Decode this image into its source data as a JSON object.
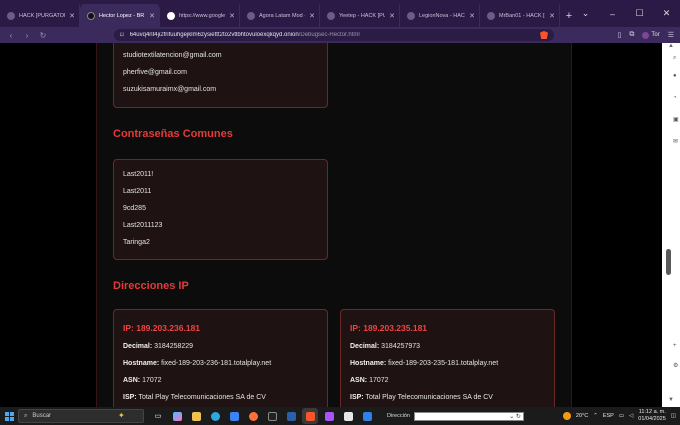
{
  "tabs": [
    {
      "title": "HACK [PURGATORY]",
      "active": false
    },
    {
      "title": "Hector Lopez - BR",
      "active": true
    },
    {
      "title": "https://www.google.co",
      "active": false
    },
    {
      "title": "Agora Latam Mod - R",
      "active": false
    },
    {
      "title": "Yeetep - HACK [PURG",
      "active": false
    },
    {
      "title": "LegionNova - HACK [I",
      "active": false
    },
    {
      "title": "MrBan01 - HACK [PUR",
      "active": false
    }
  ],
  "toolbar": {
    "url_host": "64uvq4nt4ji2frifuuhgejklm6zysiettt2to2vtlbhtovuloexqkqyd.onion",
    "url_path": "/Debugsec-Hector.html",
    "tor_label": "Tor"
  },
  "emails": [
    "studiotextilatencion@gmail.com",
    "pherfive@gmail.com",
    "suzukisamuraimx@gmail.com"
  ],
  "passwords_heading": "Contraseñas Comunes",
  "passwords": [
    "Last2011!",
    "Last2011",
    "9cd285",
    "Last2011123",
    "Taringa2"
  ],
  "ip_heading": "Direcciones IP",
  "labels": {
    "decimal": "Decimal:",
    "hostname": "Hostname:",
    "asn": "ASN:",
    "isp": "ISP:"
  },
  "ips": [
    {
      "title": "IP: 189.203.236.181",
      "decimal": "3184258229",
      "hostname": "fixed-189-203-236-181.totalplay.net",
      "asn": "17072",
      "isp": "Total Play Telecomunicaciones SA de CV"
    },
    {
      "title": "IP: 189.203.235.181",
      "decimal": "3184257973",
      "hostname": "fixed-189-203-235-181.totalplay.net",
      "asn": "17072",
      "isp": "Total Play Telecomunicaciones SA de CV"
    }
  ],
  "taskbar": {
    "search_label": "Buscar",
    "address_label": "Dirección",
    "temperature": "20°C",
    "language": "ESP",
    "time": "11:12 a. m.",
    "date": "01/04/2025"
  }
}
